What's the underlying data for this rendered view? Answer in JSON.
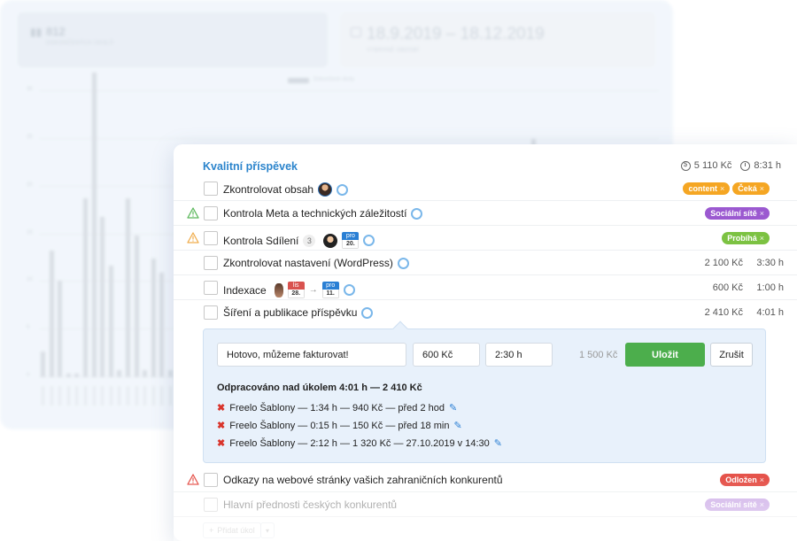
{
  "background": {
    "stat_count": {
      "value": "812",
      "label": "DOKONČENÝCH ÚKOLŮ"
    },
    "stat_range": {
      "value": "18.9.2019 – 18.12.2019",
      "label": "VYBRANÉ OBDOBÍ"
    },
    "chart_legend": "Dokončené úkoly",
    "axis_labels": [
      "30",
      "25",
      "20",
      "15",
      "10",
      "5",
      "0"
    ],
    "bar_levels": [
      0.07,
      0.34,
      0.26,
      0.01,
      0.01,
      0.48,
      0.82,
      0.43,
      0.3,
      0.02,
      0.48,
      0.38,
      0.02,
      0.32,
      0.28,
      0.02,
      0.06,
      0.42,
      0.02,
      0.02
    ]
  },
  "card": {
    "title": "Kvalitní příspěvek",
    "total_price": "5 110 Kč",
    "total_time": "8:31 h"
  },
  "tasks": [
    {
      "label": "Zkontrolovat obsah",
      "tags": [
        {
          "text": "content",
          "color": "#f5a623"
        },
        {
          "text": "Čeká",
          "color": "#f5a623"
        }
      ]
    },
    {
      "label": "Kontrola Meta a technických záležitostí",
      "tags": [
        {
          "text": "Sociální sítě",
          "color": "#9b59d0"
        }
      ]
    },
    {
      "label": "Kontrola Sdílení",
      "comment_count": "3",
      "due_badge": {
        "month": "pro",
        "day": "20."
      },
      "tags": [
        {
          "text": "Probíhá",
          "color": "#7cc242"
        }
      ]
    },
    {
      "label": "Zkontrolovat nastavení (WordPress)",
      "price": "2 100 Kč",
      "time": "3:30 h"
    },
    {
      "label": "Indexace",
      "from_badge": {
        "month": "lis",
        "day": "28."
      },
      "arrow": "→",
      "to_badge": {
        "month": "pro",
        "day": "11."
      },
      "price": "600 Kč",
      "time": "1:00 h"
    },
    {
      "label": "Šíření a publikace příspěvku",
      "price": "2 410 Kč",
      "time": "4:01 h"
    },
    {
      "label": "Odkazy na webové stránky vašich zahraničních konkurentů",
      "tags": [
        {
          "text": "Odložen",
          "color": "#e5534b"
        }
      ]
    },
    {
      "label": "Hlavní přednosti českých konkurentů",
      "tags": [
        {
          "text": "Sociální sítě",
          "color": "#9b59d0"
        }
      ]
    }
  ],
  "edit_panel": {
    "note_value": "Hotovo, můžeme fakturovat!",
    "price_value": "600 Kč",
    "hours_value": "2:30 h",
    "estimate": "1 500 Kč",
    "save_label": "Uložit",
    "cancel_label": "Zrušit",
    "worked_title": "Odpracováno nad úkolem 4:01 h — 2 410 Kč",
    "entries": [
      {
        "text": "Freelo Šablony — 1:34 h — 940 Kč — před 2 hod"
      },
      {
        "text": "Freelo Šablony — 0:15 h — 150 Kč — před 18 min"
      },
      {
        "text": "Freelo Šablony — 2:12 h — 1 320 Kč — 27.10.2019 v 14:30"
      }
    ]
  },
  "footer": {
    "add_task_label": "Přidat úkol",
    "add_icon": "+",
    "dropdown_icon": "▾"
  },
  "icons": {
    "remove_tag": "×",
    "delete_entry": "✖",
    "edit_entry": "✎"
  },
  "colors": {
    "accent": "#2b84cc",
    "save": "#4cae4c",
    "warning": "#f0ad4e",
    "danger": "#e5534b"
  }
}
